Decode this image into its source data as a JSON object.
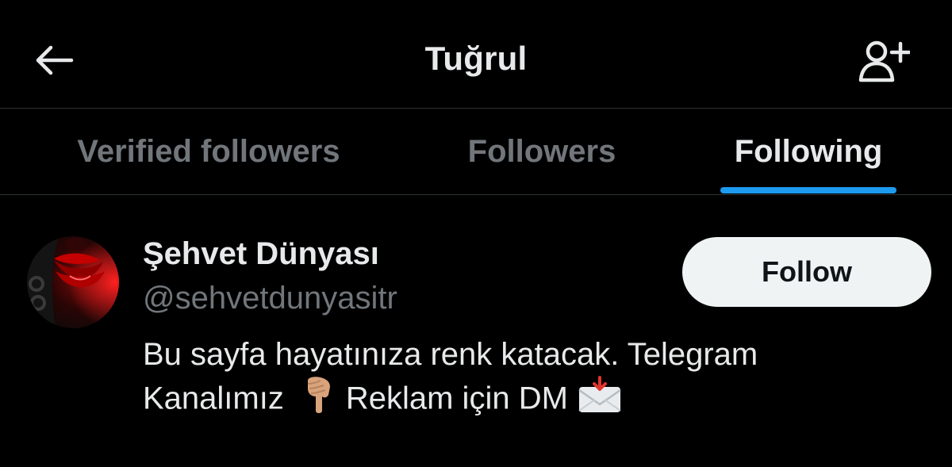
{
  "header": {
    "title": "Tuğrul",
    "back_icon": "arrow-left-icon",
    "add_icon": "add-user-icon"
  },
  "tabs": [
    {
      "label": "Verified followers",
      "active": false
    },
    {
      "label": "Followers",
      "active": false
    },
    {
      "label": "Following",
      "active": true
    }
  ],
  "user": {
    "name": "Şehvet Dünyası",
    "handle": "@sehvetdunyasitr",
    "bio_line1": "Bu sayfa hayatınıza renk katacak. Telegram",
    "bio_line2_a": "Kanalımız",
    "bio_line2_b": "Reklam için DM",
    "avatar_icon": "red-lips-avatar",
    "follow_label": "Follow"
  },
  "colors": {
    "background": "#000000",
    "text_primary": "#e7e9ea",
    "text_secondary": "#71767b",
    "accent": "#1d9bf0",
    "divider": "#2f3336",
    "button_bg": "#eff3f4",
    "button_text": "#0f1419"
  }
}
